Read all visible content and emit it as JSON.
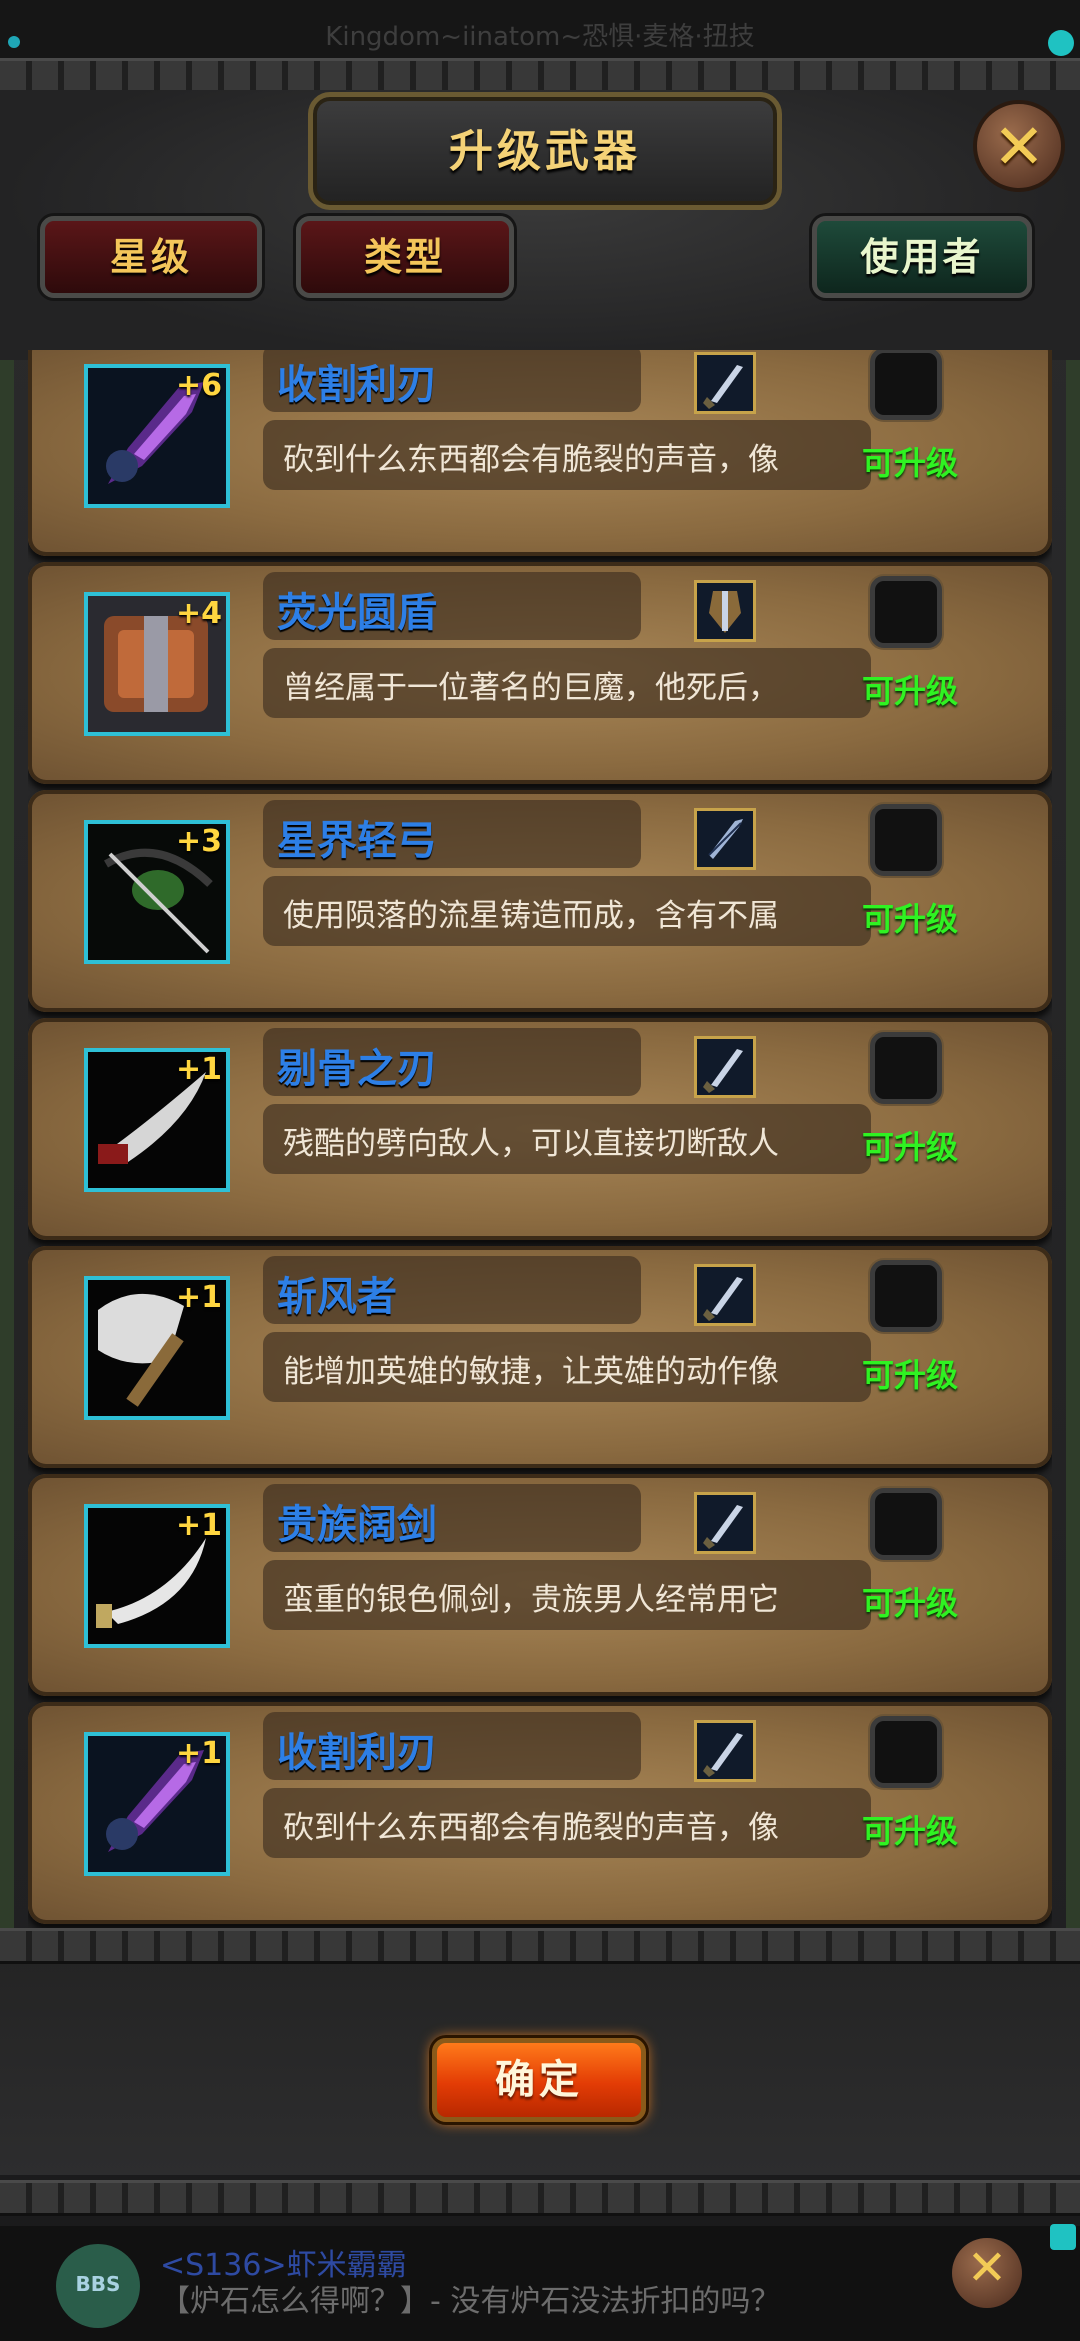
{
  "window": {
    "title": "Kingdom~iinatom~恐惧·麦格·扭技"
  },
  "header": {
    "title": "升级武器",
    "close_icon": "close-x-icon",
    "filters": [
      {
        "label": "星级",
        "style": "red"
      },
      {
        "label": "类型",
        "style": "red"
      },
      {
        "label": "使用者",
        "style": "green"
      }
    ]
  },
  "items": [
    {
      "name": "收割利刃",
      "plus": "+6",
      "desc": "砍到什么东西都会有脆裂的声音，像",
      "type_icon": "sword-icon",
      "status": "可升级",
      "thumb_icon": "purple-crystal-blade-icon"
    },
    {
      "name": "荧光圆盾",
      "plus": "+4",
      "desc": "曾经属于一位著名的巨魔，他死后，",
      "type_icon": "shield-icon",
      "status": "可升级",
      "thumb_icon": "wooden-shield-icon"
    },
    {
      "name": "星界轻弓",
      "plus": "+3",
      "desc": "使用陨落的流星铸造而成，含有不属",
      "type_icon": "bow-icon",
      "status": "可升级",
      "thumb_icon": "green-bow-icon"
    },
    {
      "name": "剔骨之刃",
      "plus": "+1",
      "desc": "残酷的劈向敌人，可以直接切断敌人",
      "type_icon": "sword-icon",
      "status": "可升级",
      "thumb_icon": "curved-blade-icon"
    },
    {
      "name": "斩风者",
      "plus": "+1",
      "desc": "能增加英雄的敏捷，让英雄的动作像",
      "type_icon": "sword-icon",
      "status": "可升级",
      "thumb_icon": "axe-icon"
    },
    {
      "name": "贵族阔剑",
      "plus": "+1",
      "desc": "蛮重的银色佩剑，贵族男人经常用它",
      "type_icon": "sword-icon",
      "status": "可升级",
      "thumb_icon": "silver-saber-icon"
    },
    {
      "name": "收割利刃",
      "plus": "+1",
      "desc": "砍到什么东西都会有脆裂的声音，像",
      "type_icon": "sword-icon",
      "status": "可升级",
      "thumb_icon": "purple-crystal-blade-icon"
    }
  ],
  "confirm": {
    "label": "确定"
  },
  "chat": {
    "badge": "BBS",
    "name": "<S136>虾米霸霸",
    "message": "【炉石怎么得啊？】- 没有炉石没法折扣的吗？"
  },
  "colors": {
    "title_gold": "#f4d277",
    "item_name_blue": "#2d7fe6",
    "status_green": "#2ff222",
    "thumb_border": "#2ec0d6",
    "confirm_orange": "#e33c05"
  }
}
